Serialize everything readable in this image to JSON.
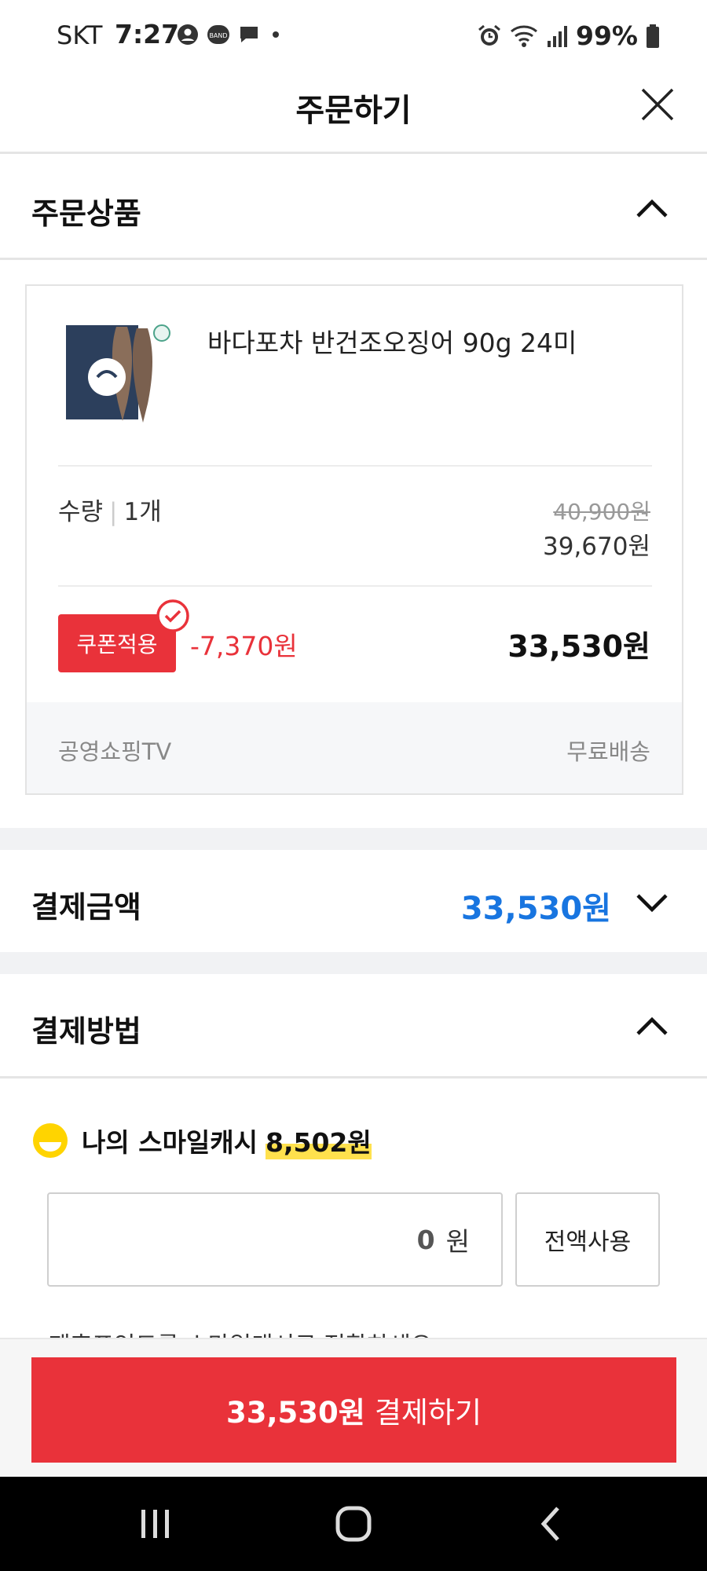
{
  "status_bar": {
    "carrier": "SKT",
    "time": "7:27",
    "battery": "99%"
  },
  "header": {
    "title": "주문하기"
  },
  "order_items": {
    "label": "주문상품",
    "product": {
      "name": "바다포차 반건조오징어 90g 24미",
      "quantity_label": "수량",
      "quantity_value": "1개",
      "original_price": "40,900원",
      "sale_price": "39,670원",
      "coupon_label": "쿠폰적용",
      "coupon_discount": "-7,370원",
      "final_price": "33,530원",
      "seller": "공영쇼핑TV",
      "shipping": "무료배송"
    }
  },
  "payment_amount": {
    "label": "결제금액",
    "value": "33,530원"
  },
  "payment_method": {
    "label": "결제방법",
    "smile_cash_label": "나의 스마일캐시",
    "smile_cash_amount": "8,502원",
    "cash_input_value": "0",
    "cash_input_unit": "원",
    "use_all_label": "전액사용",
    "convert_link": "제휴포인트를 스마일캐시로 전환하세요 >"
  },
  "checkout": {
    "amount": "33,530원",
    "label": "결제하기"
  },
  "colors": {
    "accent_red": "#e9323a",
    "amount_blue": "#1875e0",
    "smile_yellow": "#ffd400"
  },
  "icons": [
    "close-icon",
    "chevron-up-icon",
    "chevron-down-icon",
    "check-circle-icon",
    "smile-icon",
    "nav-recent-icon",
    "nav-home-icon",
    "nav-back-icon"
  ]
}
